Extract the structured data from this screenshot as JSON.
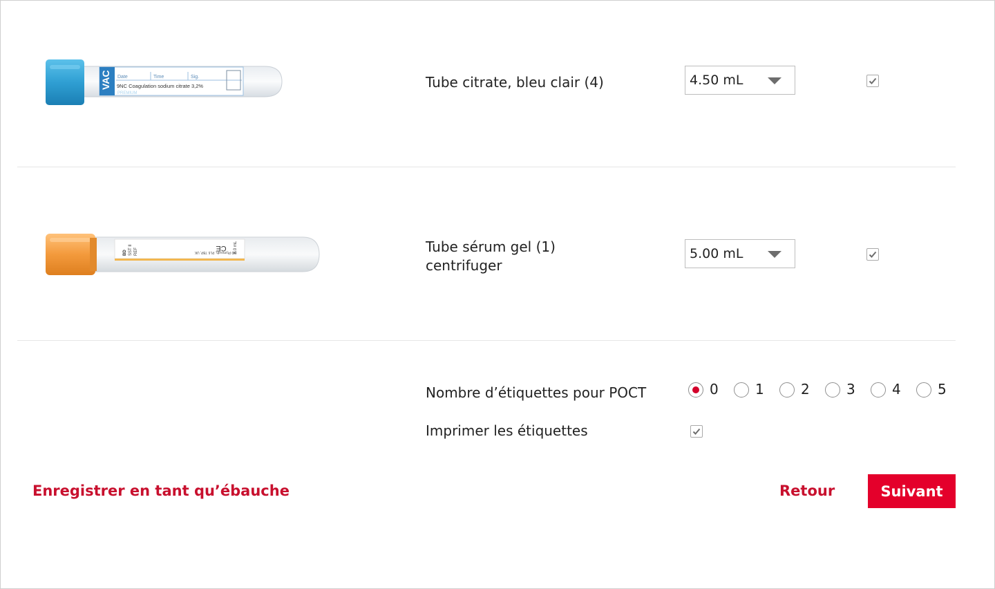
{
  "tubes": [
    {
      "name": "Tube citrate, bleu clair (4)",
      "volume": "4.50 mL",
      "selected": true,
      "cap_color": "#2f9fd3",
      "image_text": {
        "brand": "VAC",
        "fields": [
          "Date",
          "Time",
          "Sig."
        ],
        "line": "9NC Coagulation sodium citrate 3,2%",
        "band": "PREMIUM"
      }
    },
    {
      "name_line1": "Tube sérum gel (1)",
      "name_line2": "centrifuger",
      "volume": "5.00 mL",
      "selected": true,
      "cap_color": "#f39a3c",
      "image_text": {
        "brand": "BD",
        "codes": [
          "SST II",
          "REF"
        ],
        "maker": "BD Plymouth, PL6 7BP, UK",
        "mark": "CE",
        "size": "5.0 mL"
      }
    }
  ],
  "poct": {
    "label": "Nombre d’étiquettes pour POCT",
    "options": [
      "0",
      "1",
      "2",
      "3",
      "4",
      "5"
    ],
    "selected": "0"
  },
  "print": {
    "label": "Imprimer les étiquettes",
    "checked": true
  },
  "actions": {
    "save_draft": "Enregistrer en tant qu’ébauche",
    "back": "Retour",
    "next": "Suivant"
  },
  "colors": {
    "accent": "#e4002b",
    "link": "#c8102e"
  }
}
